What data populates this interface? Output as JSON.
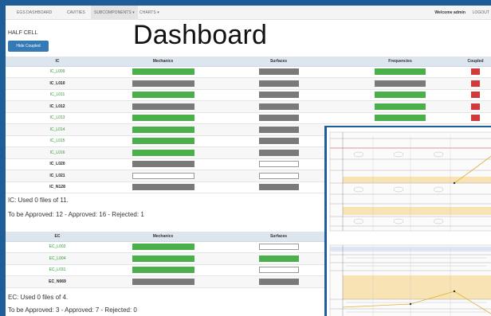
{
  "nav": {
    "items": [
      {
        "label": "EGS DASHBOARD",
        "active": false
      },
      {
        "label": "CAVITIES",
        "active": false
      },
      {
        "label": "SUBCOMPONENTS ▾",
        "active": true
      },
      {
        "label": "CHARTS ▾",
        "active": false
      }
    ],
    "welcome": "Welcome admin",
    "logout": "LOGOUT"
  },
  "page_title": "Dashboard",
  "section_title": "HALF CELL",
  "hide_coupled_label": "Hide Coupled",
  "ic_table": {
    "headers": [
      "IC",
      "Mechanics",
      "Surfaces",
      "Frequencies",
      "Coupled"
    ],
    "rows": [
      {
        "name": "IC_L009",
        "status": "ok",
        "mech": "green",
        "surf": "gray",
        "freq": "green",
        "coupled": "red"
      },
      {
        "name": "IC_L010",
        "status": "plain",
        "mech": "gray",
        "surf": "gray",
        "freq": "gray",
        "coupled": "red"
      },
      {
        "name": "IC_L011",
        "status": "ok",
        "mech": "green",
        "surf": "gray",
        "freq": "green",
        "coupled": "red"
      },
      {
        "name": "IC_L012",
        "status": "plain",
        "mech": "gray",
        "surf": "gray",
        "freq": "green",
        "coupled": "red"
      },
      {
        "name": "IC_L013",
        "status": "ok",
        "mech": "green",
        "surf": "gray",
        "freq": "green",
        "coupled": "red"
      },
      {
        "name": "IC_L014",
        "status": "ok",
        "mech": "green",
        "surf": "gray",
        "freq": "green",
        "coupled": "red"
      },
      {
        "name": "IC_L015",
        "status": "ok",
        "mech": "green",
        "surf": "gray",
        "freq": "",
        "coupled": ""
      },
      {
        "name": "IC_L016",
        "status": "ok",
        "mech": "green",
        "surf": "gray",
        "freq": "",
        "coupled": ""
      },
      {
        "name": "IC_L020",
        "status": "plain",
        "mech": "gray",
        "surf": "empty",
        "freq": "",
        "coupled": ""
      },
      {
        "name": "IC_L021",
        "status": "plain",
        "mech": "empty",
        "surf": "empty",
        "freq": "",
        "coupled": ""
      },
      {
        "name": "IC_N128",
        "status": "plain",
        "mech": "gray",
        "surf": "gray",
        "freq": "",
        "coupled": ""
      }
    ]
  },
  "ic_summary": {
    "used": "IC: Used 0 files of 11.",
    "approval": "To be Approved: 12 - Approved: 16 - Rejected: 1"
  },
  "ec_table": {
    "headers": [
      "EC",
      "Mechanics",
      "Surfaces"
    ],
    "rows": [
      {
        "name": "EC_L003",
        "status": "ok",
        "mech": "green",
        "surf": "empty"
      },
      {
        "name": "EC_L004",
        "status": "ok",
        "mech": "green",
        "surf": "green"
      },
      {
        "name": "EC_L031",
        "status": "ok",
        "mech": "green",
        "surf": "empty"
      },
      {
        "name": "EC_N069",
        "status": "plain",
        "mech": "gray",
        "surf": "gray"
      }
    ]
  },
  "ec_summary": {
    "used": "EC: Used 0 files of 4.",
    "approval": "To be Approved: 3 - Approved: 7 - Rejected: 0"
  },
  "colors": {
    "green": "#4bb04b",
    "gray": "#7a7a7a",
    "red": "#d23a3a",
    "header_bg": "#dde6ef",
    "button_blue": "#337ab7",
    "desktop_blue": "#1d5d98"
  }
}
